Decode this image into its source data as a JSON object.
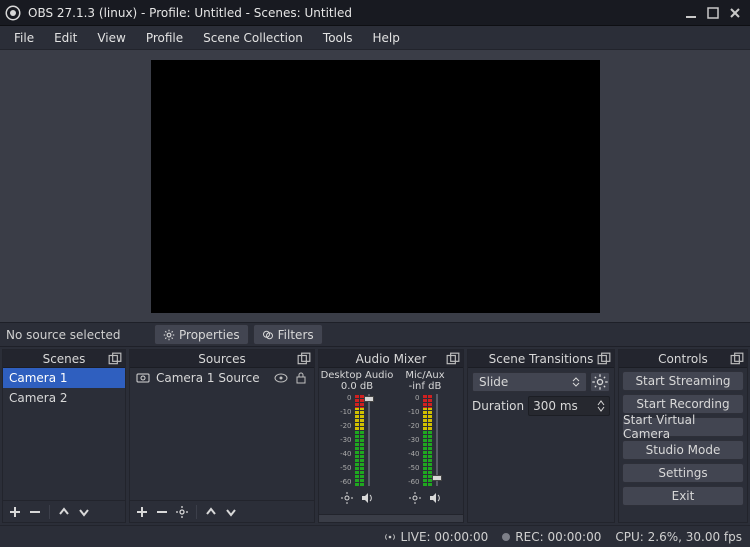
{
  "title": "OBS 27.1.3 (linux) - Profile: Untitled - Scenes: Untitled",
  "menu": [
    "File",
    "Edit",
    "View",
    "Profile",
    "Scene Collection",
    "Tools",
    "Help"
  ],
  "mid": {
    "no_source": "No source selected",
    "properties": "Properties",
    "filters": "Filters"
  },
  "scenes": {
    "title": "Scenes",
    "items": [
      "Camera 1",
      "Camera 2"
    ],
    "selected_index": 0
  },
  "sources": {
    "title": "Sources",
    "items": [
      {
        "label": "Camera 1 Source"
      }
    ]
  },
  "mixer": {
    "title": "Audio Mixer",
    "channels": [
      {
        "name": "Desktop Audio",
        "db": "0.0 dB",
        "thumb_top_pct": 2
      },
      {
        "name": "Mic/Aux",
        "db": "-inf dB",
        "thumb_top_pct": 94
      }
    ],
    "scale_ticks": [
      "0",
      "-10",
      "-20",
      "-30",
      "-40",
      "-50",
      "-60"
    ]
  },
  "transitions": {
    "title": "Scene Transitions",
    "selected": "Slide",
    "duration_label": "Duration",
    "duration_value": "300 ms"
  },
  "controls": {
    "title": "Controls",
    "buttons": [
      "Start Streaming",
      "Start Recording",
      "Start Virtual Camera",
      "Studio Mode",
      "Settings",
      "Exit"
    ]
  },
  "status": {
    "live": "LIVE: 00:00:00",
    "rec": "REC: 00:00:00",
    "cpu": "CPU: 2.6%, 30.00 fps"
  }
}
